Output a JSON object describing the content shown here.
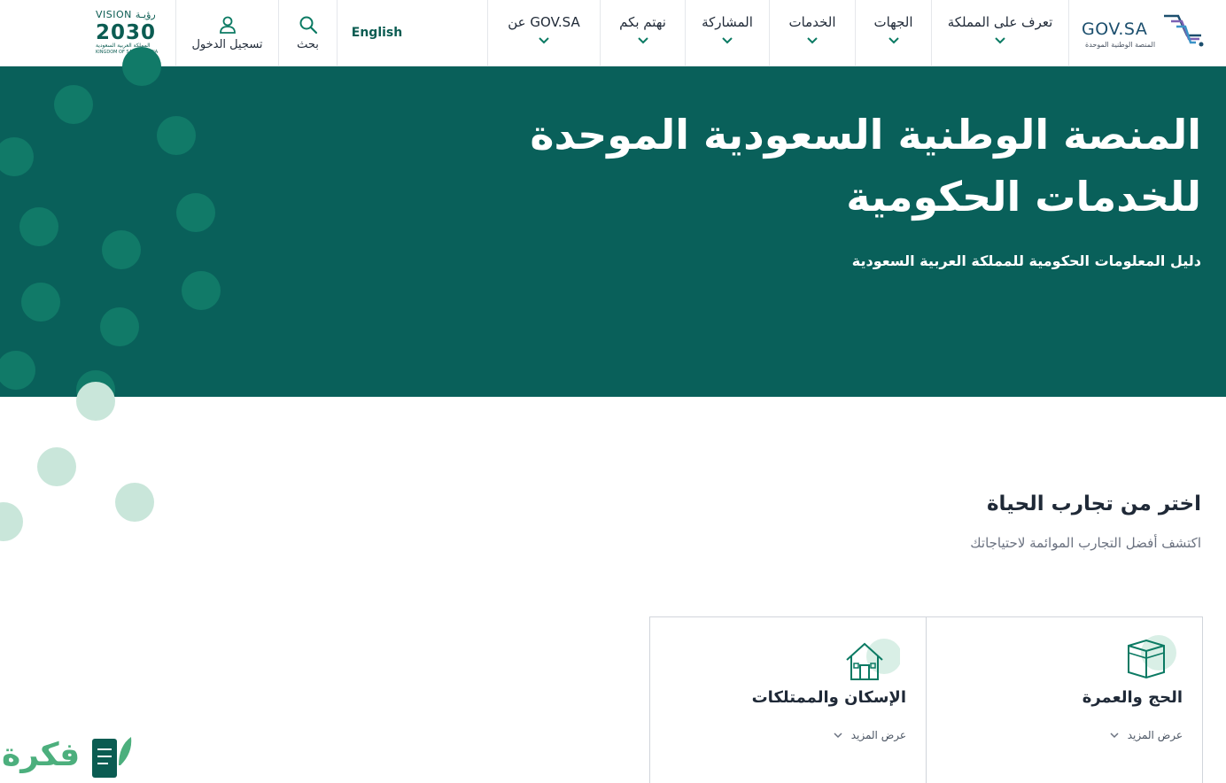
{
  "header": {
    "logo": {
      "brand": "GOV.SA",
      "subtitle": "المنصة الوطنية الموحدة"
    },
    "nav": [
      {
        "label": "تعرف على المملكة"
      },
      {
        "label": "الجهات"
      },
      {
        "label": "الخدمات"
      },
      {
        "label": "المشاركة"
      },
      {
        "label": "نهتم بكم"
      },
      {
        "label": "عن GOV.SA"
      }
    ],
    "language": "English",
    "search_label": "بحث",
    "login_label": "تسجيل الدخول",
    "vision": {
      "top": "VISION رؤيـة",
      "number": "2030",
      "line1": "المملكة العربية السعودية",
      "line2": "KINGDOM OF SAUDI ARABIA"
    }
  },
  "hero": {
    "title": "المنصة الوطنية السعودية الموحدة للخدمات الحكومية",
    "subtitle": "دليل المعلومات الحكومية للمملكة العربية السعودية"
  },
  "life_experiences": {
    "title": "اختر من تجارب الحياة",
    "subtitle": "اكتشف أفضل التجارب الموائمة لاحتياجاتك",
    "cards": [
      {
        "title": "الحج والعمرة",
        "more": "عرض المزيد",
        "icon": "kaaba-icon"
      },
      {
        "title": "الإسكان والممتلكات",
        "more": "عرض المزيد",
        "icon": "house-icon"
      }
    ]
  },
  "watermark": "فكرة",
  "colors": {
    "primary": "#09605a",
    "accent": "#4caf7d",
    "dots_dark": "#117a68",
    "dots_light": "#c9e6da"
  }
}
